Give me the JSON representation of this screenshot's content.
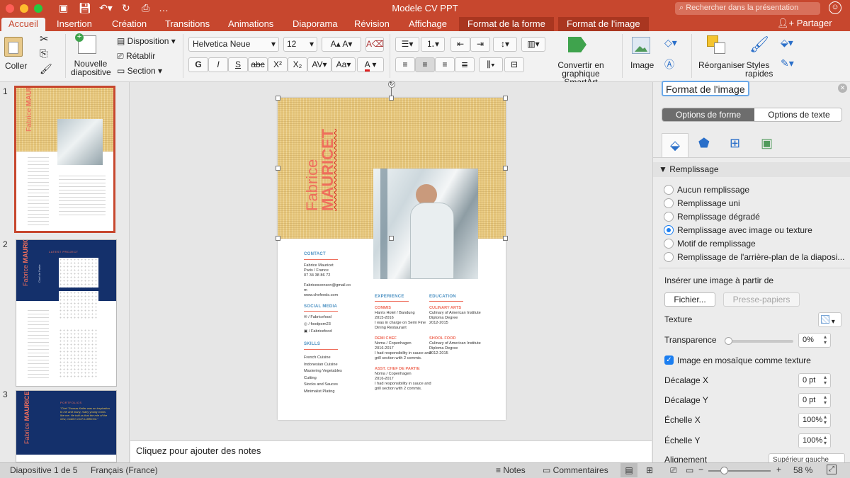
{
  "window": {
    "title": "Modele CV PPT"
  },
  "search": {
    "placeholder": "Rechercher dans la présentation"
  },
  "tabs": [
    "Accueil",
    "Insertion",
    "Création",
    "Transitions",
    "Animations",
    "Diaporama",
    "Révision",
    "Affichage"
  ],
  "context_tabs": [
    "Format de la forme",
    "Format de l'image"
  ],
  "share_label": "Partager",
  "ribbon": {
    "paste": "Coller",
    "new_slide": "Nouvelle diapositive",
    "layout": "Disposition",
    "reset": "Rétablir",
    "section": "Section",
    "font": "Helvetica Neue",
    "size": "12",
    "convert_smartart": "Convertir en graphique SmartArt",
    "image": "Image",
    "arrange": "Réorganiser",
    "quick_styles": "Styles rapides"
  },
  "thumbnails": [
    {
      "num": "1",
      "name": "Fabrice",
      "surname": "MAURICET"
    },
    {
      "num": "2",
      "name": "Fabrice",
      "surname": "MAURICET",
      "header": "LATEST PROJECT",
      "subtitle": "Chef de Partie"
    },
    {
      "num": "3",
      "name": "Fabrice",
      "surname": "MAURICET",
      "header": "PORTFOLIOS",
      "quote": "\"Chef Thomas Keller was an inspiration to me and many, many young cooks like me. He told us that the role of the new, modern chef is different.\""
    }
  ],
  "slide": {
    "first_name": "Fabrice",
    "last_name": "MAURICET",
    "contact_h": "CONTACT",
    "contact": [
      "Fabrice Mauricet",
      "Paris / France",
      "07 34 38 86 72",
      "",
      "Fabricesvenson@gmail.co",
      "m",
      "www.chefeeds.com"
    ],
    "social_h": "SOCIAL MEDIA",
    "social": [
      "/ Fabricefood",
      "/ foodporn23",
      "/ Fabricefood"
    ],
    "skills_h": "SKILLS",
    "skills": [
      "French Cuisine",
      "Indonesian Cuisine",
      "Mastering Vegetables",
      "Cutting",
      "Stocks and Sauces",
      "Minimalist Plating"
    ],
    "experience_h": "EXPERIENCE",
    "experience": [
      {
        "title": "COMMIS",
        "lines": [
          "Harris Hotel / Bandung",
          "2015-2016",
          "I was in charge on Semi Fine",
          "Dining Restaurant"
        ]
      },
      {
        "title": "DEMI CHEF",
        "lines": [
          "Noma / Copenhagen",
          "2016-2017",
          "I had responsibility in sauce and",
          "grill section with 2 commis."
        ]
      },
      {
        "title": "ASST. CHEF DE PARTIE",
        "lines": [
          "Noma / Copenhagen",
          "2016-2017",
          "I had responsibility in sauce and",
          "grill section with 2 commis."
        ]
      }
    ],
    "education_h": "EDUCATION",
    "education": [
      {
        "title": "CULINARY ARTS",
        "lines": [
          "Culinary of American Institute",
          "Diploma Degree",
          "2012-2015"
        ]
      },
      {
        "title": "SHOOL FOOD",
        "lines": [
          "Culinary of American Institute",
          "Diploma Degree",
          "2012-2015"
        ]
      }
    ]
  },
  "notes_placeholder": "Cliquez pour ajouter des notes",
  "pane": {
    "title": "Format de l'image",
    "seg_shape": "Options de forme",
    "seg_text": "Options de texte",
    "section": "Remplissage",
    "fill_options": [
      "Aucun remplissage",
      "Remplissage uni",
      "Remplissage dégradé",
      "Remplissage avec image ou texture",
      "Motif de remplissage",
      "Remplissage de l'arrière-plan de la diaposi..."
    ],
    "selected_fill": 3,
    "insert_from": "Insérer une image à partir de",
    "file_btn": "Fichier...",
    "clipboard_btn": "Presse-papiers",
    "texture_label": "Texture",
    "transparency_label": "Transparence",
    "transparency_value": "0%",
    "transparency_level": 0,
    "tile_label": "Image en mosaïque comme texture",
    "tile_checked": true,
    "offset_x_label": "Décalage X",
    "offset_x": "0 pt",
    "offset_y_label": "Décalage Y",
    "offset_y": "0 pt",
    "scale_x_label": "Échelle X",
    "scale_x": "100%",
    "scale_y_label": "Échelle Y",
    "scale_y": "100%",
    "align_label": "Alignement",
    "align_value": "Supérieur gauche"
  },
  "status": {
    "slide_info": "Diapositive 1 de 5",
    "language": "Français (France)",
    "notes": "Notes",
    "comments": "Commentaires",
    "zoom": "58 %",
    "zoom_level": 0.58
  },
  "colors": {
    "accent": "#c7472e",
    "salmon": "#ef6e5c",
    "navy": "#14306b",
    "blue": "#1b7ef0"
  }
}
